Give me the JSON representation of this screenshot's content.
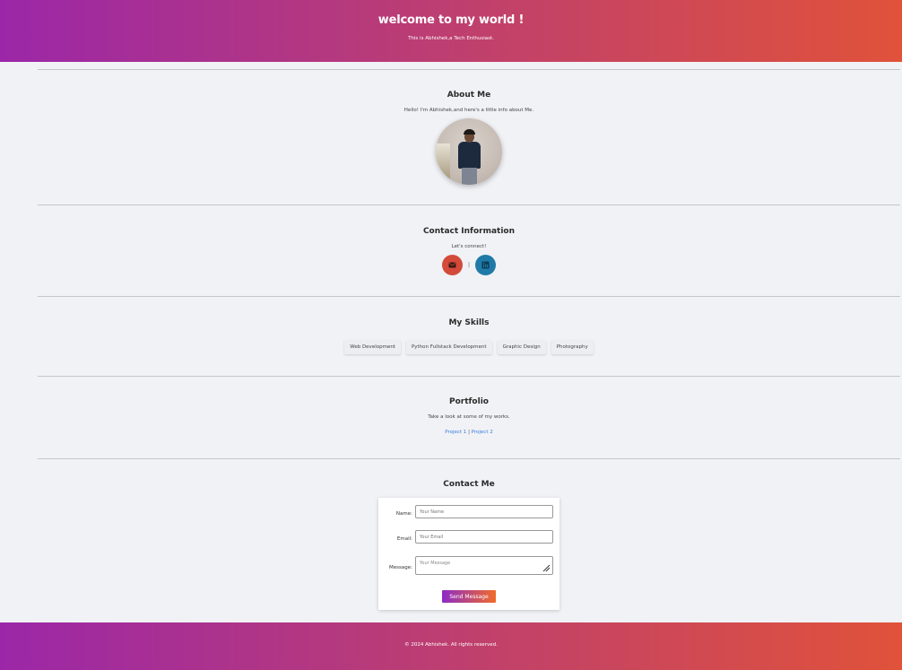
{
  "header": {
    "title": "welcome to my world !",
    "subtitle": "This is Abhishek,a Tech Enthusiast."
  },
  "about": {
    "heading": "About Me",
    "text": "Hello! I'm Abhishek,and here's a little info about Me."
  },
  "contact_info": {
    "heading": "Contact Information",
    "text": "Let's connect!",
    "separator": "|",
    "icons": [
      "envelope-icon",
      "linkedin-icon"
    ],
    "colors": {
      "email": "#d44a3a",
      "linkedin": "#1f7aa8"
    }
  },
  "skills": {
    "heading": "My Skills",
    "items": [
      "Web Development",
      "Python Fullstack Development",
      "Graphic Design",
      "Photography"
    ]
  },
  "portfolio": {
    "heading": "Portfolio",
    "text": "Take a look at some of my works.",
    "links": [
      "Project 1",
      "Project 2"
    ],
    "separator": "|"
  },
  "contact_form": {
    "heading": "Contact Me",
    "name_label": "Name:",
    "name_placeholder": "Your Name",
    "email_label": "Email:",
    "email_placeholder": "Your Email",
    "message_label": "Message:",
    "message_placeholder": "Your Message",
    "submit_label": "Send Message"
  },
  "footer": {
    "text": "© 2024 Abhishek. All rights reserved."
  },
  "colors": {
    "gradient_start": "#9b27a8",
    "gradient_end": "#e0523a",
    "link": "#3d7be0"
  }
}
